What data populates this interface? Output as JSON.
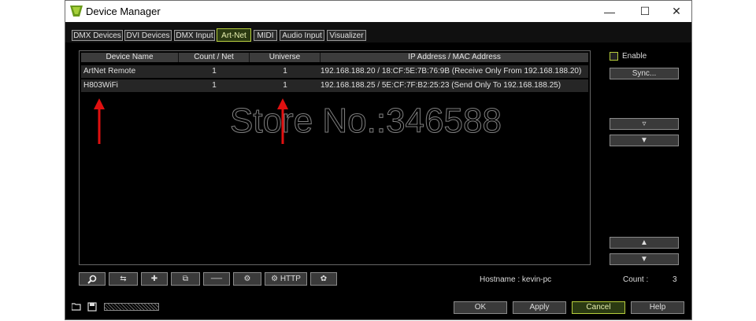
{
  "window": {
    "title": "Device Manager"
  },
  "tabs": [
    {
      "label": "DMX Devices",
      "active": false
    },
    {
      "label": "DVI Devices",
      "active": false
    },
    {
      "label": "DMX Input",
      "active": false
    },
    {
      "label": "Art-Net",
      "active": true
    },
    {
      "label": "MIDI",
      "active": false
    },
    {
      "label": "Audio Input",
      "active": false
    },
    {
      "label": "Visualizer",
      "active": false
    }
  ],
  "table": {
    "columns": [
      "Device Name",
      "Count / Net",
      "Universe",
      "IP Address / MAC Address"
    ],
    "rows": [
      {
        "name": "ArtNet Remote",
        "count": "1",
        "universe": "1",
        "ip": "192.168.188.20 / 18:CF:5E:7B:76:9B (Receive Only From 192.168.188.20)"
      },
      {
        "name": "H803WiFi",
        "count": "1",
        "universe": "1",
        "ip": "192.168.188.25 / 5E:CF:7F:B2:25:23 (Send Only To 192.168.188.25)"
      }
    ]
  },
  "watermark": "Store No.:346588",
  "side": {
    "enable_label": "Enable",
    "sync_label": "Sync..."
  },
  "toolbar": {
    "http_label": "HTTP"
  },
  "status": {
    "hostname_label": "Hostname : kevin-pc",
    "count_label": "Count :",
    "count_value": "3"
  },
  "footer": {
    "ok": "OK",
    "apply": "Apply",
    "cancel": "Cancel",
    "help": "Help"
  },
  "colors": {
    "accent": "#b6cd3c",
    "arrow": "#e01010"
  }
}
